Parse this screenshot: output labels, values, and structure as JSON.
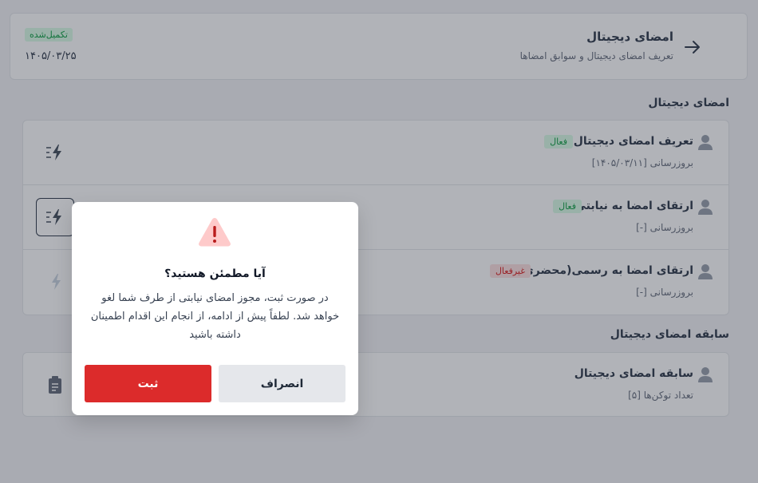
{
  "header": {
    "title": "امضای دیجیتال",
    "subtitle": "تعریف امضای دیجیتال و سوابق امضاها",
    "status": "تکمیل‌شده",
    "date": "۱۴۰۵/۰۳/۲۵",
    "back_icon": "arrow-right-icon"
  },
  "section_signatures": {
    "title": "امضای دیجیتال",
    "rows": [
      {
        "title": "تعریف امضای دیجیتال",
        "badge": "فعال",
        "badge_kind": "active",
        "sub": "بروزرسانی [۱۴۰۵/۰۳/۱۱]",
        "action_icon": "bolt-icon"
      },
      {
        "title": "ارتقای امضا به نیابتی",
        "badge": "فعال",
        "badge_kind": "active",
        "sub": "بروزرسانی [-]",
        "action_icon": "bolt-icon"
      },
      {
        "title": "ارتقای امضا به رسمی(محضری)",
        "badge": "غیرفعال",
        "badge_kind": "inactive",
        "sub": "بروزرسانی [-]",
        "action_icon": "bolt-icon"
      }
    ]
  },
  "section_history": {
    "title": "سابقه امضای دیجیتال",
    "rows": [
      {
        "title": "سابقه امضای دیجیتال",
        "sub": "تعداد توکن‌ها [۵]",
        "action_icon": "clipboard-icon"
      }
    ]
  },
  "modal": {
    "title": "آیا مطمئن هستید؟",
    "body": "در صورت ثبت، مجوز امضای نیابتی از طرف شما لغو خواهد شد. لطفاً پیش از ادامه، از انجام این اقدام اطمینان داشته باشید",
    "confirm_label": "ثبت",
    "cancel_label": "انصراف",
    "warning_icon": "warning-triangle-icon"
  },
  "colors": {
    "confirm": "#dc2b2b",
    "active_badge": "#16a34a",
    "inactive_badge": "#dc2626",
    "warning": "#dc2626"
  }
}
